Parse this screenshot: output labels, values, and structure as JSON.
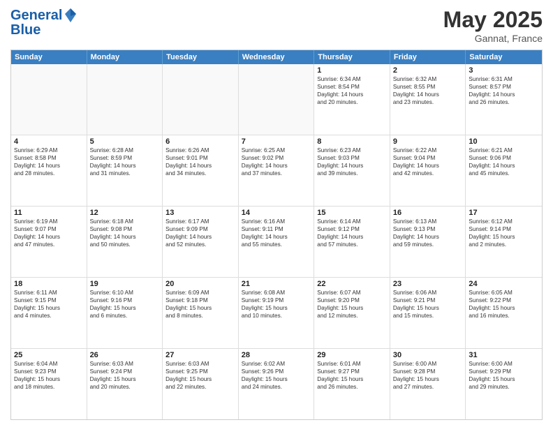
{
  "header": {
    "logo_line1": "General",
    "logo_line2": "Blue",
    "month": "May 2025",
    "location": "Gannat, France"
  },
  "days_of_week": [
    "Sunday",
    "Monday",
    "Tuesday",
    "Wednesday",
    "Thursday",
    "Friday",
    "Saturday"
  ],
  "weeks": [
    [
      {
        "num": "",
        "text": "",
        "empty": true
      },
      {
        "num": "",
        "text": "",
        "empty": true
      },
      {
        "num": "",
        "text": "",
        "empty": true
      },
      {
        "num": "",
        "text": "",
        "empty": true
      },
      {
        "num": "1",
        "text": "Sunrise: 6:34 AM\nSunset: 8:54 PM\nDaylight: 14 hours\nand 20 minutes."
      },
      {
        "num": "2",
        "text": "Sunrise: 6:32 AM\nSunset: 8:55 PM\nDaylight: 14 hours\nand 23 minutes."
      },
      {
        "num": "3",
        "text": "Sunrise: 6:31 AM\nSunset: 8:57 PM\nDaylight: 14 hours\nand 26 minutes."
      }
    ],
    [
      {
        "num": "4",
        "text": "Sunrise: 6:29 AM\nSunset: 8:58 PM\nDaylight: 14 hours\nand 28 minutes."
      },
      {
        "num": "5",
        "text": "Sunrise: 6:28 AM\nSunset: 8:59 PM\nDaylight: 14 hours\nand 31 minutes."
      },
      {
        "num": "6",
        "text": "Sunrise: 6:26 AM\nSunset: 9:01 PM\nDaylight: 14 hours\nand 34 minutes."
      },
      {
        "num": "7",
        "text": "Sunrise: 6:25 AM\nSunset: 9:02 PM\nDaylight: 14 hours\nand 37 minutes."
      },
      {
        "num": "8",
        "text": "Sunrise: 6:23 AM\nSunset: 9:03 PM\nDaylight: 14 hours\nand 39 minutes."
      },
      {
        "num": "9",
        "text": "Sunrise: 6:22 AM\nSunset: 9:04 PM\nDaylight: 14 hours\nand 42 minutes."
      },
      {
        "num": "10",
        "text": "Sunrise: 6:21 AM\nSunset: 9:06 PM\nDaylight: 14 hours\nand 45 minutes."
      }
    ],
    [
      {
        "num": "11",
        "text": "Sunrise: 6:19 AM\nSunset: 9:07 PM\nDaylight: 14 hours\nand 47 minutes."
      },
      {
        "num": "12",
        "text": "Sunrise: 6:18 AM\nSunset: 9:08 PM\nDaylight: 14 hours\nand 50 minutes."
      },
      {
        "num": "13",
        "text": "Sunrise: 6:17 AM\nSunset: 9:09 PM\nDaylight: 14 hours\nand 52 minutes."
      },
      {
        "num": "14",
        "text": "Sunrise: 6:16 AM\nSunset: 9:11 PM\nDaylight: 14 hours\nand 55 minutes."
      },
      {
        "num": "15",
        "text": "Sunrise: 6:14 AM\nSunset: 9:12 PM\nDaylight: 14 hours\nand 57 minutes."
      },
      {
        "num": "16",
        "text": "Sunrise: 6:13 AM\nSunset: 9:13 PM\nDaylight: 14 hours\nand 59 minutes."
      },
      {
        "num": "17",
        "text": "Sunrise: 6:12 AM\nSunset: 9:14 PM\nDaylight: 15 hours\nand 2 minutes."
      }
    ],
    [
      {
        "num": "18",
        "text": "Sunrise: 6:11 AM\nSunset: 9:15 PM\nDaylight: 15 hours\nand 4 minutes."
      },
      {
        "num": "19",
        "text": "Sunrise: 6:10 AM\nSunset: 9:16 PM\nDaylight: 15 hours\nand 6 minutes."
      },
      {
        "num": "20",
        "text": "Sunrise: 6:09 AM\nSunset: 9:18 PM\nDaylight: 15 hours\nand 8 minutes."
      },
      {
        "num": "21",
        "text": "Sunrise: 6:08 AM\nSunset: 9:19 PM\nDaylight: 15 hours\nand 10 minutes."
      },
      {
        "num": "22",
        "text": "Sunrise: 6:07 AM\nSunset: 9:20 PM\nDaylight: 15 hours\nand 12 minutes."
      },
      {
        "num": "23",
        "text": "Sunrise: 6:06 AM\nSunset: 9:21 PM\nDaylight: 15 hours\nand 15 minutes."
      },
      {
        "num": "24",
        "text": "Sunrise: 6:05 AM\nSunset: 9:22 PM\nDaylight: 15 hours\nand 16 minutes."
      }
    ],
    [
      {
        "num": "25",
        "text": "Sunrise: 6:04 AM\nSunset: 9:23 PM\nDaylight: 15 hours\nand 18 minutes."
      },
      {
        "num": "26",
        "text": "Sunrise: 6:03 AM\nSunset: 9:24 PM\nDaylight: 15 hours\nand 20 minutes."
      },
      {
        "num": "27",
        "text": "Sunrise: 6:03 AM\nSunset: 9:25 PM\nDaylight: 15 hours\nand 22 minutes."
      },
      {
        "num": "28",
        "text": "Sunrise: 6:02 AM\nSunset: 9:26 PM\nDaylight: 15 hours\nand 24 minutes."
      },
      {
        "num": "29",
        "text": "Sunrise: 6:01 AM\nSunset: 9:27 PM\nDaylight: 15 hours\nand 26 minutes."
      },
      {
        "num": "30",
        "text": "Sunrise: 6:00 AM\nSunset: 9:28 PM\nDaylight: 15 hours\nand 27 minutes."
      },
      {
        "num": "31",
        "text": "Sunrise: 6:00 AM\nSunset: 9:29 PM\nDaylight: 15 hours\nand 29 minutes."
      }
    ]
  ]
}
